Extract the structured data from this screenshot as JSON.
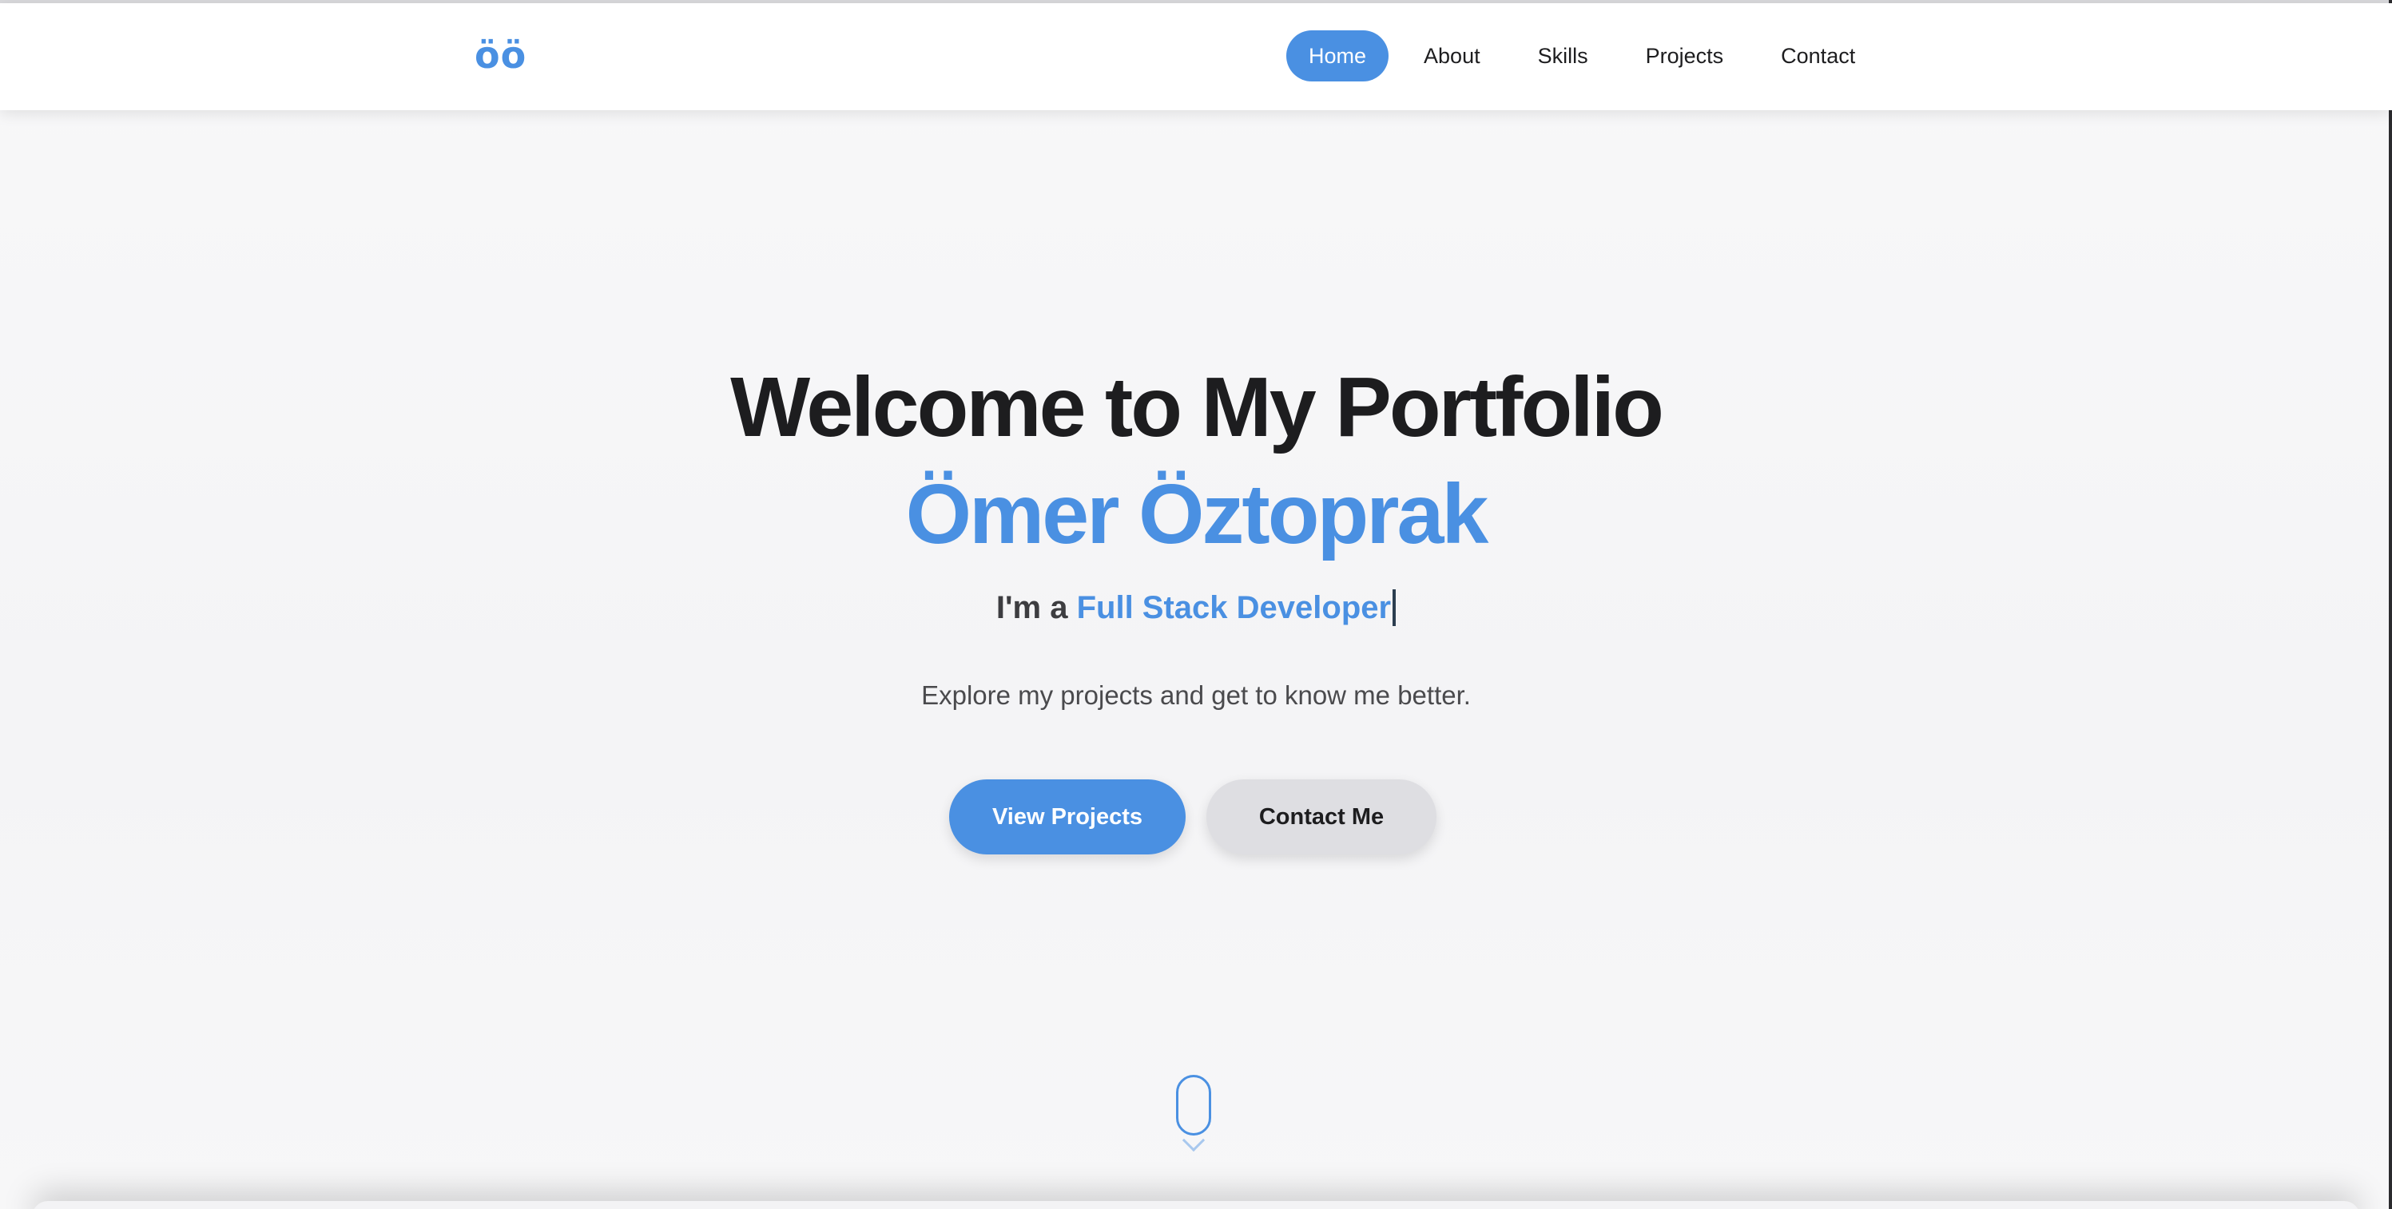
{
  "brand": {
    "logo_text": "öö",
    "accent_color": "#4a90e2"
  },
  "nav": {
    "items": [
      {
        "label": "Home",
        "active": true
      },
      {
        "label": "About",
        "active": false
      },
      {
        "label": "Skills",
        "active": false
      },
      {
        "label": "Projects",
        "active": false
      },
      {
        "label": "Contact",
        "active": false
      }
    ]
  },
  "hero": {
    "title": "Welcome to My Portfolio",
    "name": "Ömer Öztoprak",
    "role_prefix": "I'm a ",
    "role_text": "Full Stack Developer",
    "subtitle": "Explore my projects and get to know me better.",
    "primary_button": "View Projects",
    "secondary_button": "Contact Me"
  },
  "scroll_indicator": {
    "icon": "mouse-scroll-icon",
    "chevron_icon": "chevron-down-icon"
  }
}
